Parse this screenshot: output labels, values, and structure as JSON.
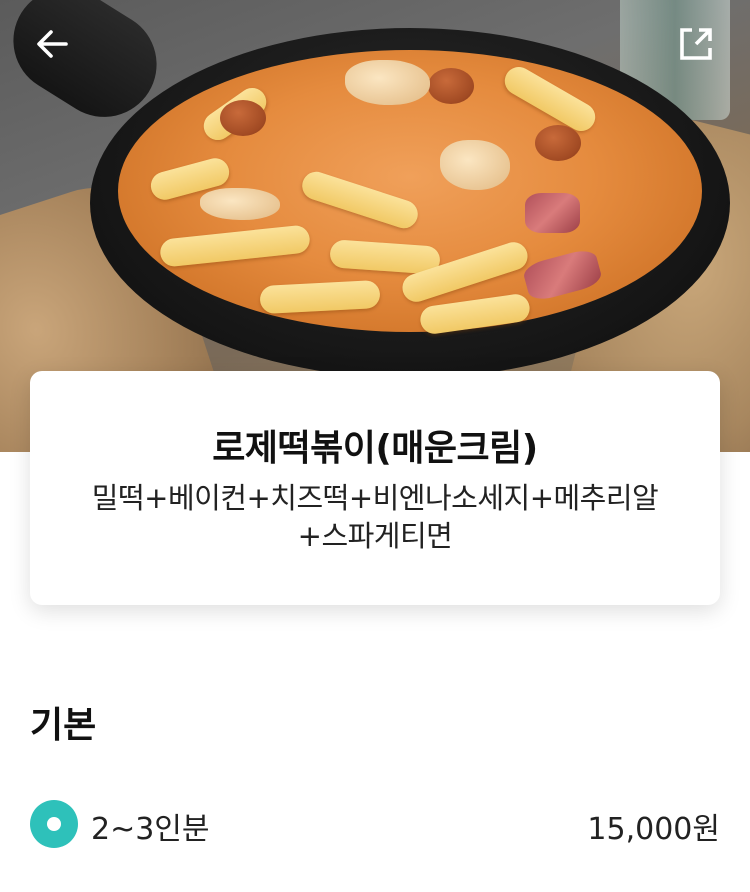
{
  "header": {
    "back_icon": "arrow-left-icon",
    "share_icon": "share-external-icon"
  },
  "menu": {
    "name": "로제떡볶이(매운크림)",
    "description_line1": "밀떡+베이컨+치즈떡+비엔나소세지+메추리알",
    "description_line2": "+스파게티면"
  },
  "options": {
    "section_title": "기본",
    "items": [
      {
        "label": "2~3인분",
        "price": "15,000원",
        "selected": true
      }
    ]
  },
  "colors": {
    "accent": "#2ec1ba",
    "text_primary": "#111111",
    "text_secondary": "#222222"
  }
}
